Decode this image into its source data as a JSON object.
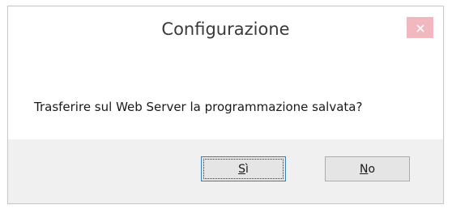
{
  "dialog": {
    "title": "Configurazione",
    "message": "Trasferire sul Web Server la programmazione salvata?",
    "close_icon": "close-icon",
    "buttons": {
      "yes": {
        "mnemonic": "S",
        "rest": "ì"
      },
      "no": {
        "mnemonic": "N",
        "rest": "o"
      }
    }
  },
  "colors": {
    "close_button_bg": "#f2b8c0",
    "footer_bg": "#f0f0f0",
    "default_button_border": "#3c7fb1"
  }
}
